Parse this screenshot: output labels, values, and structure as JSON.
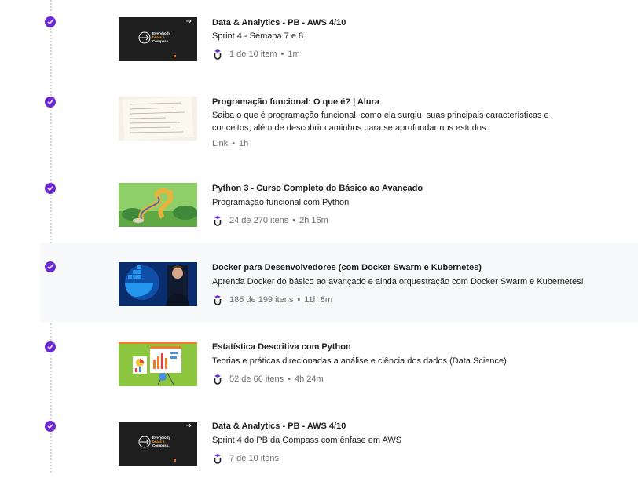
{
  "brand_color": "#6d28d2",
  "items": [
    {
      "title": "Data & Analytics - PB - AWS 4/10",
      "description": "Sprint 4 - Semana 7 e 8",
      "source_icon": "udemy-icon",
      "progress": "1 de 10 item",
      "separator": "•",
      "duration": "1m",
      "thumb_text": [
        "Everybody",
        "beats a",
        "Compass."
      ]
    },
    {
      "title": "Programação funcional: O que é? | Alura",
      "description": "Saiba o que é programação funcional, como ela surgiu, suas principais características e conceitos, além de descobrir caminhos para se aprofundar nos estudos.",
      "type_label": "Link",
      "separator": "•",
      "duration": "1h"
    },
    {
      "title": "Python 3 - Curso Completo do Básico ao Avançado",
      "description": "Programação funcional com Python",
      "source_icon": "udemy-icon",
      "progress": "24 de 270 itens",
      "separator": "•",
      "duration": "2h 16m"
    },
    {
      "title": "Docker para Desenvolvedores (com Docker Swarm e Kubernetes)",
      "description": "Aprenda Docker do básico ao avançado e ainda orquestração com Docker Swarm e Kubernetes!",
      "source_icon": "udemy-icon",
      "progress": "185 de 199 itens",
      "separator": "•",
      "duration": "11h 8m"
    },
    {
      "title": "Estatística Descritiva com Python",
      "description": "Teorias e práticas direcionadas a análise e ciência dos dados (Data Science).",
      "source_icon": "udemy-icon",
      "progress": "52 de 66 itens",
      "separator": "•",
      "duration": "4h 24m"
    },
    {
      "title": "Data & Analytics - PB - AWS 4/10",
      "description": "Sprint 4 do PB da Compass com ênfase em AWS",
      "source_icon": "udemy-icon",
      "progress": "7 de 10 itens",
      "thumb_text": [
        "Everybody",
        "beats a",
        "Compass."
      ]
    }
  ]
}
